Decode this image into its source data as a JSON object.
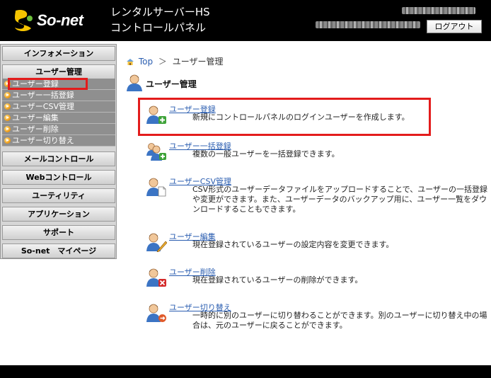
{
  "header": {
    "logo_text": "So-net",
    "title_line1": "レンタルサーバーHS",
    "title_line2": "コントロールパネル",
    "logout_label": "ログアウト"
  },
  "sidebar": {
    "items": [
      {
        "label": "インフォメーション"
      },
      {
        "label": "ユーザー管理"
      },
      {
        "label": "メールコントロール"
      },
      {
        "label": "Webコントロール"
      },
      {
        "label": "ユーティリティ"
      },
      {
        "label": "アプリケーション"
      },
      {
        "label": "サポート"
      },
      {
        "label": "So-net　マイページ"
      }
    ],
    "subitems": [
      {
        "label": "ユーザー登録"
      },
      {
        "label": "ユーザー一括登録"
      },
      {
        "label": "ユーザーCSV管理"
      },
      {
        "label": "ユーザー編集"
      },
      {
        "label": "ユーザー削除"
      },
      {
        "label": "ユーザー切り替え"
      }
    ]
  },
  "breadcrumb": {
    "top": "Top",
    "separator": "＞",
    "current": "ユーザー管理"
  },
  "page_title": "ユーザー管理",
  "entries": [
    {
      "link": "ユーザー登録",
      "desc": "新規にコントロールパネルのログインユーザーを作成します。",
      "icon": "user-add-icon"
    },
    {
      "link": "ユーザー一括登録",
      "desc": "複数の一般ユーザーを一括登録できます。",
      "icon": "users-bulk-add-icon"
    },
    {
      "link": "ユーザーCSV管理",
      "desc": "CSV形式のユーザーデータファイルをアップロードすることで、ユーザーの一括登録や変更ができます。また、ユーザーデータのバックアップ用に、ユーザー一覧をダウンロードすることもできます。",
      "icon": "user-csv-icon"
    },
    {
      "link": "ユーザー編集",
      "desc": "現在登録されているユーザーの設定内容を変更できます。",
      "icon": "user-edit-icon"
    },
    {
      "link": "ユーザー削除",
      "desc": "現在登録されているユーザーの削除ができます。",
      "icon": "user-delete-icon"
    },
    {
      "link": "ユーザー切り替え",
      "desc": "一時的に別のユーザーに切り替わることができます。別のユーザーに切り替え中の場合は、元のユーザーに戻ることができます。",
      "icon": "user-switch-icon"
    }
  ],
  "colors": {
    "highlight": "#e31c1c",
    "link": "#2a5db0",
    "header_bg": "#000000"
  }
}
